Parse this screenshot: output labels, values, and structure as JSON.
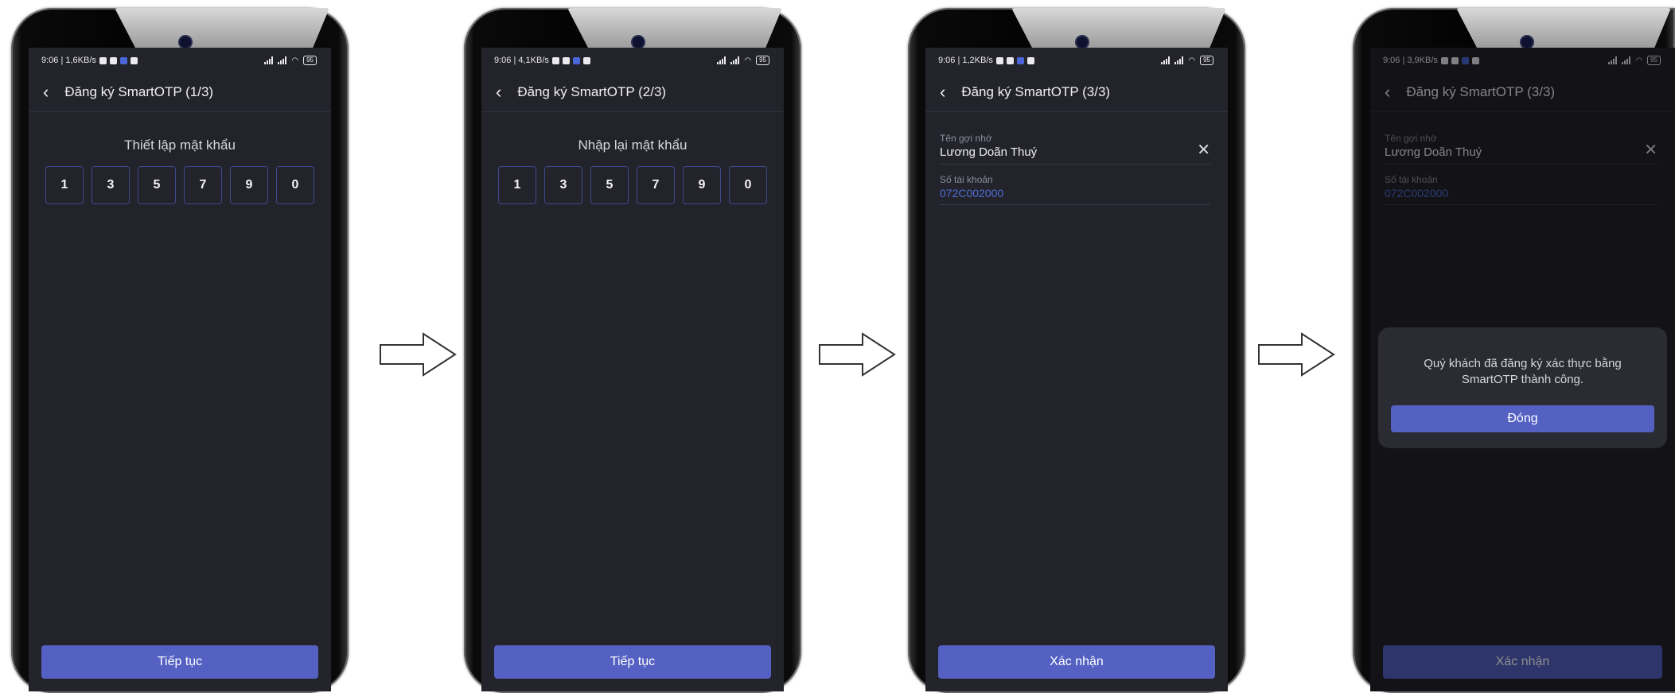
{
  "screens": [
    {
      "status": {
        "time": "9:06 | 1,6KB/s",
        "battery": "95"
      },
      "title": "Đăng ký SmartOTP (1/3)",
      "prompt": "Thiết lập mật khẩu",
      "pin": [
        "1",
        "3",
        "5",
        "7",
        "9",
        "0"
      ],
      "button": "Tiếp tục"
    },
    {
      "status": {
        "time": "9:06 | 4,1KB/s",
        "battery": "95"
      },
      "title": "Đăng ký SmartOTP (2/3)",
      "prompt": "Nhập lại mật khẩu",
      "pin": [
        "1",
        "3",
        "5",
        "7",
        "9",
        "0"
      ],
      "button": "Tiếp tục"
    },
    {
      "status": {
        "time": "9:06 | 1,2KB/s",
        "battery": "95"
      },
      "title": "Đăng ký SmartOTP (3/3)",
      "fields": {
        "nickname_label": "Tên gợi nhớ",
        "nickname_value": "Lương Doãn Thuý",
        "account_label": "Số tài khoản",
        "account_value": "072C002000"
      },
      "button": "Xác nhận"
    },
    {
      "status": {
        "time": "9:06 | 3,9KB/s",
        "battery": "95"
      },
      "title": "Đăng ký SmartOTP (3/3)",
      "fields": {
        "nickname_label": "Tên gợi nhớ",
        "nickname_value": "Lương Doãn Thuý",
        "account_label": "Số tài khoản",
        "account_value": "072C002000"
      },
      "button": "Xác nhận",
      "dialog": {
        "message": "Quý khách đã đăng ký xác thực bằng SmartOTP thành công.",
        "button": "Đóng"
      }
    }
  ],
  "icons": {
    "back": "chevron-left-icon",
    "clear": "close-icon",
    "flow_arrow": "right-arrow-icon"
  },
  "colors": {
    "screen_bg": "#23232b",
    "primary": "#5461c3",
    "pin_border": "#3e4a8c",
    "account_link": "#4f6dd6"
  }
}
